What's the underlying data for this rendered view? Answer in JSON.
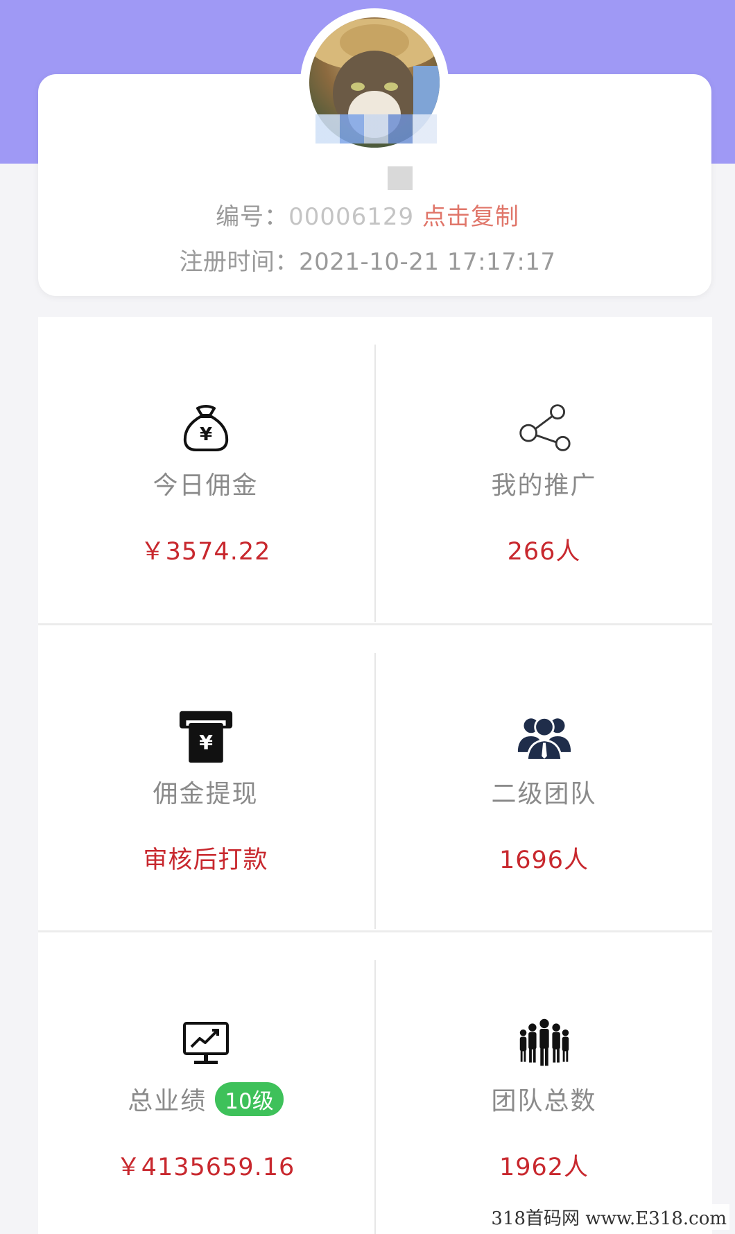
{
  "profile": {
    "avatar_alt": "cat-with-straw-hat",
    "id_label": "编号：",
    "id_value": "00006129",
    "copy_label": "点击复制",
    "reg_label": "注册时间：",
    "reg_time": "2021-10-21 17:17:17"
  },
  "stats": [
    {
      "icon": "money-bag-icon",
      "label": "今日佣金",
      "value": "￥3574.22"
    },
    {
      "icon": "share-icon",
      "label": "我的推广",
      "value": "266人"
    },
    {
      "icon": "withdraw-icon",
      "label": "佣金提现",
      "value": "审核后打款"
    },
    {
      "icon": "team-icon",
      "label": "二级团队",
      "value": "1696人"
    },
    {
      "icon": "chart-monitor-icon",
      "label": "总业绩",
      "badge": "10级",
      "value": "￥4135659.16"
    },
    {
      "icon": "group-icon",
      "label": "团队总数",
      "value": "1962人"
    }
  ],
  "watermark": "318首码网 www.E318.com",
  "colors": {
    "header": "#9f99f5",
    "value_red": "#c8282e",
    "copy_red": "#e0766a",
    "badge_green": "#3ec15a"
  }
}
